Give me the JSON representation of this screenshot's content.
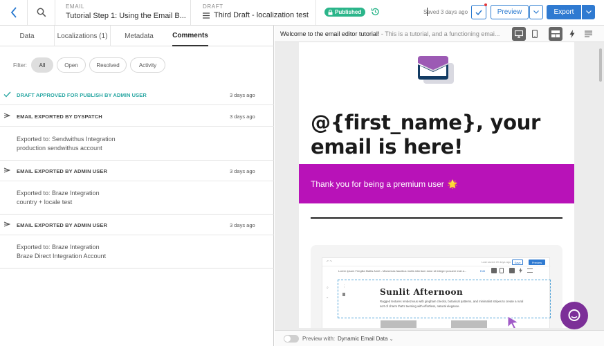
{
  "colors": {
    "accent_blue": "#2f7ad1",
    "published_green": "#2bb58a",
    "approved_teal": "#2aa7a3",
    "banner_magenta": "#b812b8",
    "chat_purple": "#7c2f98"
  },
  "topbar": {
    "back_icon": "chevron-left-icon",
    "search_icon": "search-icon",
    "email_kicker": "EMAIL",
    "email_title": "Tutorial Step 1: Using the Email B...",
    "draft_kicker": "DRAFT",
    "draft_icon": "menu-lines-icon",
    "draft_title": "Third Draft - localization test",
    "status_badge": "Published",
    "saved_text": "Saved 3 days ago",
    "preview_label": "Preview",
    "export_label": "Export"
  },
  "left": {
    "tabs": [
      {
        "label": "Data"
      },
      {
        "label": "Localizations (1)"
      },
      {
        "label": "Metadata"
      },
      {
        "label": "Comments",
        "active": true
      }
    ],
    "filter_label": "Filter:",
    "filters": [
      {
        "label": "All",
        "active": true
      },
      {
        "label": "Open"
      },
      {
        "label": "Resolved"
      },
      {
        "label": "Activity"
      }
    ],
    "entries": [
      {
        "title": "DRAFT APPROVED FOR PUBLISH BY ADMIN USER",
        "time": "3 days ago",
        "icon": "check-icon"
      },
      {
        "title": "EMAIL EXPORTED BY DYSPATCH",
        "time": "3 days ago",
        "icon": "send-icon",
        "line1": "Exported to: Sendwithus Integration",
        "line2": "production sendwithus account"
      },
      {
        "title": "EMAIL EXPORTED BY ADMIN USER",
        "time": "3 days ago",
        "icon": "send-icon",
        "line1": "Exported to: Braze Integration",
        "line2": "country + locale test"
      },
      {
        "title": "EMAIL EXPORTED BY ADMIN USER",
        "time": "3 days ago",
        "icon": "send-icon",
        "line1": "Exported to: Braze Integration",
        "line2": "Braze Direct Integration Account"
      }
    ]
  },
  "right": {
    "subject": "Welcome to the email editor tutorial!",
    "preheader": " - This is a tutorial, and a functioning emai...",
    "headline": "@{first_name}, your email is here!",
    "banner_text": "Thank you for being a premium user",
    "banner_emoji": "🌟",
    "mini": {
      "last_saved": "Last saved 20 days ago",
      "save": "Save",
      "preview": "Preview",
      "subject": "Lorem Ipsum Fringilla Mattis Amet - Maecenas faucibus mollis interdum dolor sit integer posuere erat a...",
      "edit": "Edit",
      "title": "Sunlit Afternoon",
      "desc": "Rugged textures rendezvous with gingham checks, botanical patterns, and minimalist stripes to create a rural sort of charm that's teeming with effortless, natural elegance."
    },
    "footer_label": "Preview with:",
    "footer_value": "Dynamic Email Data"
  }
}
